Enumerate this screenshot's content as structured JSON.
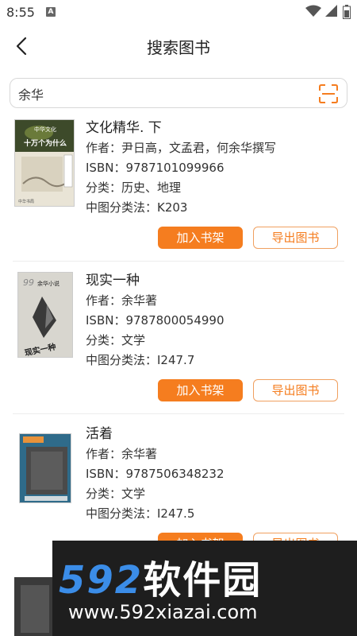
{
  "status_bar": {
    "time": "8:55",
    "notification_icon": "A"
  },
  "header": {
    "title": "搜索图书"
  },
  "search": {
    "value": "余华"
  },
  "books": [
    {
      "title": "文化精华. 下",
      "author": "作者：尹日高，文孟君，何余华撰写",
      "isbn": "ISBN：9787101099966",
      "category": "分类：历史、地理",
      "clc": "中图分类法：K203",
      "cover_text": "中华文化 十万个为什么"
    },
    {
      "title": "现实一种",
      "author": "作者：余华著",
      "isbn": "ISBN：9787800054990",
      "category": "分类：文学",
      "clc": "中图分类法：I247.7",
      "cover_text": "余华小说 现实一种"
    },
    {
      "title": "活着",
      "author": "作者：余华著",
      "isbn": "ISBN：9787506348232",
      "category": "分类：文学",
      "clc": "中图分类法：I247.5"
    }
  ],
  "actions": {
    "add_label": "加入书架",
    "export_label": "导出图书"
  },
  "watermark": {
    "brand_num": "592",
    "brand_cn": "软件园",
    "url": "www.592xiazai.com"
  },
  "colors": {
    "accent": "#f57d1f",
    "watermark_blue": "#3b8de8"
  }
}
